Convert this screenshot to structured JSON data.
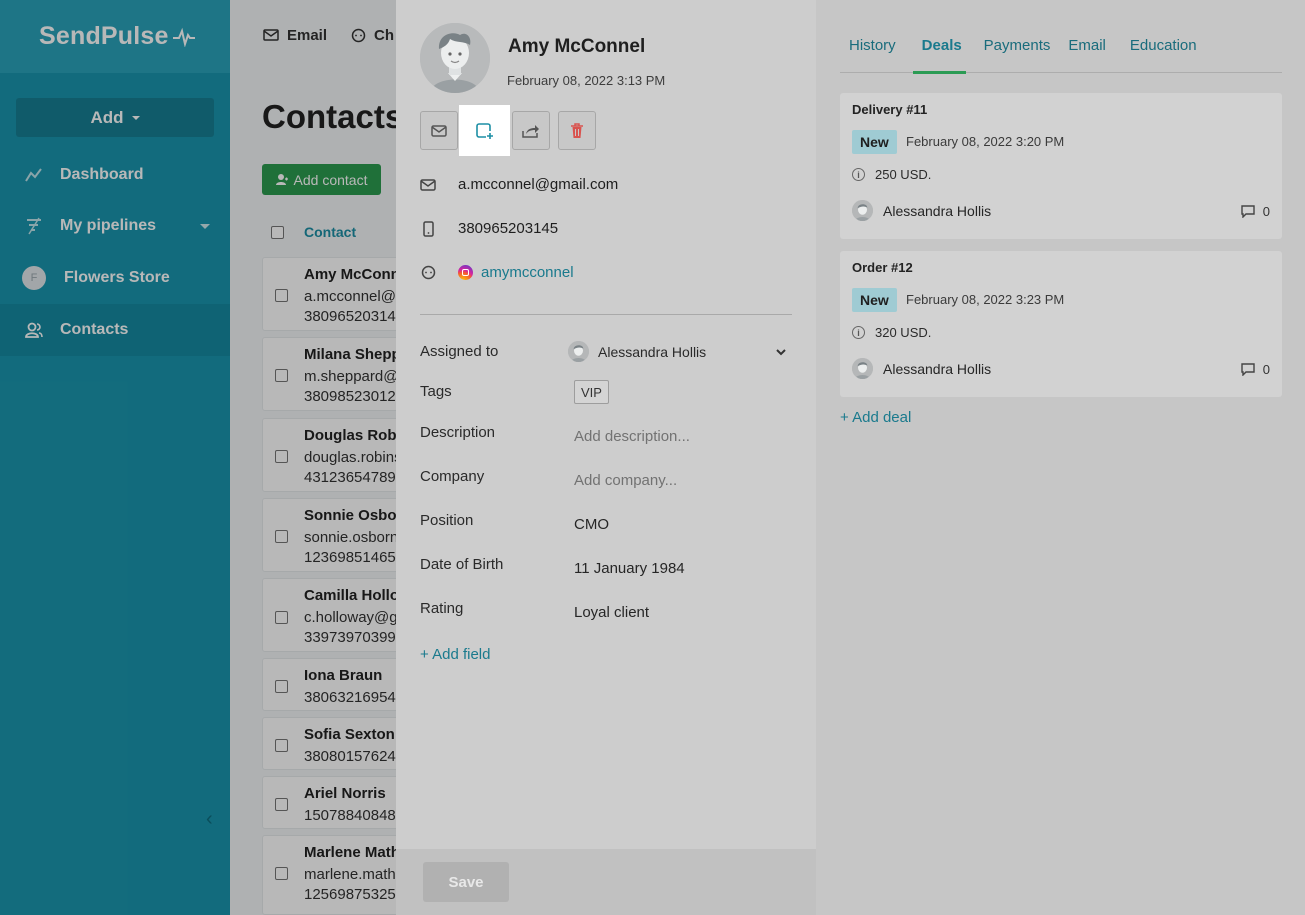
{
  "brand": {
    "name": "SendPulse"
  },
  "sidebar": {
    "add_label": "Add",
    "items": [
      {
        "label": "Dashboard",
        "icon": "dashboard-icon"
      },
      {
        "label": "My pipelines",
        "icon": "pipeline-icon"
      },
      {
        "label": "Flowers Store",
        "avatar_letter": "F"
      },
      {
        "label": "Contacts",
        "icon": "contacts-icon"
      }
    ]
  },
  "topnav": {
    "email": "Email",
    "chats": "Ch"
  },
  "contacts_page": {
    "title": "Contacts",
    "add_contact": "Add contact",
    "column_contact": "Contact",
    "rows": [
      {
        "name": "Amy McConn",
        "line2": "a.mcconnel@g",
        "line3": "38096520314"
      },
      {
        "name": "Milana Shepp",
        "line2": "m.sheppard@",
        "line3": "38098523012"
      },
      {
        "name": "Douglas Robi",
        "line2": "douglas.robins",
        "line3": "43123654789"
      },
      {
        "name": "Sonnie Osbor",
        "line2": "sonnie.osborn",
        "line3": "12369851465"
      },
      {
        "name": "Camilla Hollov",
        "line2": "c.holloway@g",
        "line3": "33973970399"
      },
      {
        "name": "Iona Braun",
        "line2": "38063216954",
        "line3": ""
      },
      {
        "name": "Sofia Sexton",
        "line2": "38080157624",
        "line3": ""
      },
      {
        "name": "Ariel Norris",
        "line2": "15078840848",
        "line3": ""
      },
      {
        "name": "Marlene Math",
        "line2": "marlene.math",
        "line3": "12569875325"
      }
    ]
  },
  "contact": {
    "name": "Amy McConnel",
    "created": "February 08, 2022 3:13 PM",
    "email": "a.mcconnel@gmail.com",
    "phone": "380965203145",
    "instagram": "amymcconnel",
    "fields": {
      "assigned_to_label": "Assigned to",
      "assigned_to_value": "Alessandra Hollis",
      "tags_label": "Tags",
      "tag": "VIP",
      "description_label": "Description",
      "description_placeholder": "Add description...",
      "company_label": "Company",
      "company_placeholder": "Add company...",
      "position_label": "Position",
      "position_value": "CMO",
      "dob_label": "Date of Birth",
      "dob_value": "11 January 1984",
      "rating_label": "Rating",
      "rating_value": "Loyal client"
    },
    "add_field": "+ Add field",
    "save": "Save"
  },
  "tabs": [
    "History",
    "Deals",
    "Payments",
    "Email",
    "Education"
  ],
  "active_tab": "Deals",
  "deals": [
    {
      "title": "Delivery #11",
      "status": "New",
      "date": "February 08, 2022 3:20 PM",
      "amount": "250 USD.",
      "owner": "Alessandra Hollis",
      "comments": "0"
    },
    {
      "title": "Order #12",
      "status": "New",
      "date": "February 08, 2022 3:23 PM",
      "amount": "320 USD.",
      "owner": "Alessandra Hollis",
      "comments": "0"
    }
  ],
  "add_deal": "+ Add deal",
  "colors": {
    "sidebar": "#1a95ad",
    "accent_green": "#2c9b4f",
    "link": "#1a7a8d",
    "delete_red": "#d9534f"
  }
}
